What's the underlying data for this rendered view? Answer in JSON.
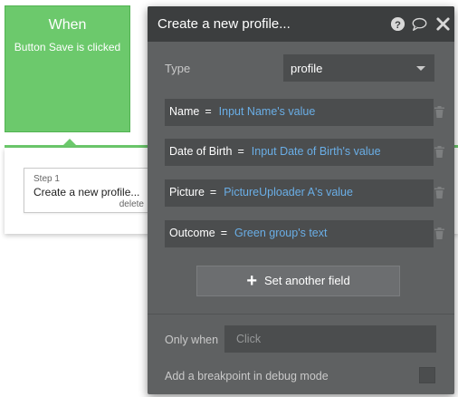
{
  "workflow": {
    "event": {
      "when": "When",
      "text": "Button Save is clicked"
    },
    "step": {
      "number": "Step 1",
      "name": "Create a new profile...",
      "delete_label": "delete"
    }
  },
  "panel": {
    "title": "Create a new profile...",
    "icons": {
      "help": "help-icon",
      "comment": "comment-icon",
      "close": "close-icon"
    },
    "type": {
      "label": "Type",
      "value": "profile"
    },
    "fields": [
      {
        "name": "Name",
        "eq": "=",
        "value": "Input Name's value"
      },
      {
        "name": "Date of Birth",
        "eq": "=",
        "value": "Input Date of Birth's value"
      },
      {
        "name": "Picture",
        "eq": "=",
        "value": "PictureUploader A's value"
      },
      {
        "name": "Outcome",
        "eq": "=",
        "value": "Green group's text"
      }
    ],
    "add_field_label": "Set another field",
    "only_when": {
      "label": "Only when",
      "placeholder": "Click"
    },
    "breakpoint_label": "Add a breakpoint in debug mode"
  },
  "colors": {
    "accent_green": "#6cc96c",
    "panel_bg": "#5f6162",
    "header_bg": "#3c3e3f",
    "value_blue": "#6aaee6"
  }
}
